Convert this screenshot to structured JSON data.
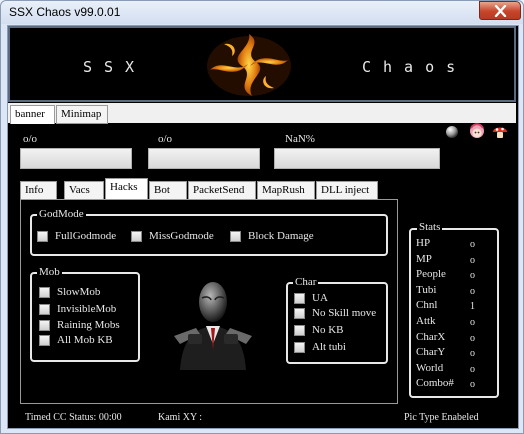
{
  "window": {
    "title": "SSX Chaos v99.0.01"
  },
  "banner": {
    "left_word": "SSX",
    "right_word": "Chaos"
  },
  "view_tabs": [
    {
      "label": "banner",
      "selected": true
    },
    {
      "label": "Minimap",
      "selected": false
    }
  ],
  "stats_top": {
    "hp_text": "o/o",
    "mp_text": "o/o",
    "exp_text": "NaN%"
  },
  "main_tabs": [
    {
      "label": "Info",
      "selected": false
    },
    {
      "label": "Vacs",
      "selected": false
    },
    {
      "label": "Hacks",
      "selected": true
    },
    {
      "label": "Bot",
      "selected": false
    },
    {
      "label": "PacketSend",
      "selected": false
    },
    {
      "label": "MapRush",
      "selected": false
    },
    {
      "label": "DLL inject",
      "selected": false
    }
  ],
  "godmode": {
    "title": "GodMode",
    "options": [
      {
        "label": "FullGodmode",
        "checked": false
      },
      {
        "label": "MissGodmode",
        "checked": false
      },
      {
        "label": "Block Damage",
        "checked": false
      }
    ]
  },
  "mob": {
    "title": "Mob",
    "options": [
      {
        "label": "SlowMob",
        "checked": false
      },
      {
        "label": "InvisibleMob",
        "checked": false
      },
      {
        "label": "Raining Mobs",
        "checked": false
      },
      {
        "label": "All Mob KB",
        "checked": false
      }
    ]
  },
  "char": {
    "title": "Char",
    "options": [
      {
        "label": "UA",
        "checked": false
      },
      {
        "label": "No Skill move",
        "checked": false
      },
      {
        "label": "No KB",
        "checked": false
      },
      {
        "label": "Alt tubi",
        "checked": false
      }
    ]
  },
  "stats": {
    "title": "Stats",
    "rows": [
      {
        "label": "HP",
        "value": "o"
      },
      {
        "label": "MP",
        "value": "o"
      },
      {
        "label": "People",
        "value": "o"
      },
      {
        "label": "Tubi",
        "value": "o"
      },
      {
        "label": "Chnl",
        "value": "1"
      },
      {
        "label": "Attk",
        "value": "o"
      },
      {
        "label": "CharX",
        "value": "o"
      },
      {
        "label": "CharY",
        "value": "o"
      },
      {
        "label": "World",
        "value": "o"
      },
      {
        "label": "Combo#",
        "value": "o"
      }
    ]
  },
  "status_bar": {
    "timed_cc": "Timed CC Status: 00:00",
    "kami_xy": "Kami XY :",
    "pic_type": "Pic Type Enabeled"
  },
  "icons": {
    "orb": "orb-icon",
    "anime": "character-icon",
    "mushroom": "mushroom-icon"
  },
  "colors": {
    "close_red": "#c6452b",
    "logo_orange": "#e07a10",
    "text_light": "#e8e8e8"
  }
}
